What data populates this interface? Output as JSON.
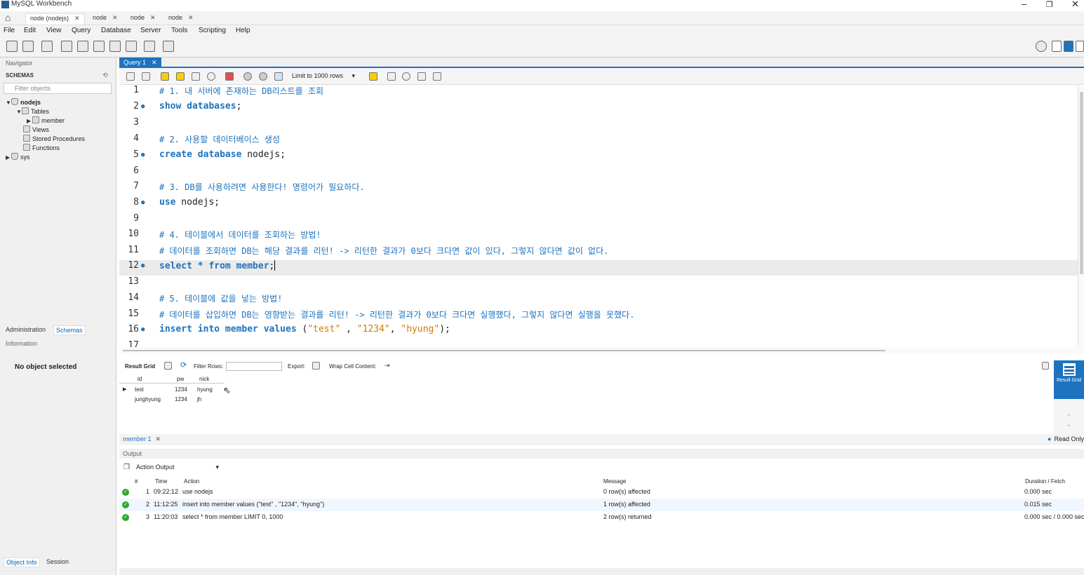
{
  "app": {
    "title": "MySQL Workbench"
  },
  "connection_tabs": [
    {
      "label": "node (nodejs)"
    },
    {
      "label": "node"
    },
    {
      "label": "node"
    },
    {
      "label": "node"
    }
  ],
  "menu": [
    "File",
    "Edit",
    "View",
    "Query",
    "Database",
    "Server",
    "Tools",
    "Scripting",
    "Help"
  ],
  "navigator": {
    "header": "Navigator",
    "schemas_label": "SCHEMAS",
    "filter_placeholder": "Filter objects",
    "tree": {
      "db1": "nodejs",
      "tables": "Tables",
      "member": "member",
      "views": "Views",
      "procs": "Stored Procedures",
      "funcs": "Functions",
      "db2": "sys"
    },
    "tabs": [
      "Administration",
      "Schemas"
    ],
    "information": "Information",
    "no_object": "No object selected",
    "bottom_tabs": [
      "Object Info",
      "Session"
    ]
  },
  "editor": {
    "tab": "Query 1",
    "limit": "Limit to 1000 rows",
    "lines": [
      {
        "n": "1",
        "text": "# 1. 내 서버에 존재하는 DB리스트를 조회"
      },
      {
        "n": "2",
        "kw": "show databases",
        "rest": ";"
      },
      {
        "n": "3"
      },
      {
        "n": "4",
        "text": "# 2. 사용할 데이터베이스 생성"
      },
      {
        "n": "5",
        "kw": "create database",
        "rest": " nodejs;"
      },
      {
        "n": "6"
      },
      {
        "n": "7",
        "text": "# 3. DB를 사용하려면 사용한다! 명령어가 필요하다."
      },
      {
        "n": "8",
        "kw": "use",
        "rest": " nodejs;"
      },
      {
        "n": "9"
      },
      {
        "n": "10",
        "text": "# 4. 테이블에서 데이터를 조회하는 방법!"
      },
      {
        "n": "11",
        "text": "# 데이터를 조회하면 DB는 해당 결과를 리턴! -> 리턴한 결과가 0보다 크다면 값이 있다, 그렇지 않다면 값이 없다."
      },
      {
        "n": "12",
        "kw": "select * from member",
        "rest": ";"
      },
      {
        "n": "13"
      },
      {
        "n": "14",
        "text": "# 5. 테이블에 값을 넣는 방법!"
      },
      {
        "n": "15",
        "text": "# 데이터를 삽입하면 DB는 영향받는 결과를 리턴! -> 리턴한 결과가 0보다 크다면 실행했다, 그렇지 않다면 실행을 못했다."
      },
      {
        "n": "16",
        "kw": "insert into member values",
        "s1": "\"test\"",
        "s2": "\"1234\"",
        "s3": "\"hyung\""
      },
      {
        "n": "17"
      }
    ]
  },
  "result": {
    "grid_label": "Result Grid",
    "filter_label": "Filter Rows:",
    "export_label": "Export:",
    "wrap_label": "Wrap Cell Content:",
    "columns": [
      "id",
      "pw",
      "nick"
    ],
    "rows": [
      [
        "test",
        "1234",
        "hyung"
      ],
      [
        "junghyung",
        "1234",
        "jh"
      ]
    ],
    "side_button": "Result Grid",
    "tab": "member 1",
    "read_only": "Read Only"
  },
  "output": {
    "header": "Output",
    "select": "Action Output",
    "columns": [
      "#",
      "Time",
      "Action",
      "Message",
      "Duration / Fetch"
    ],
    "rows": [
      {
        "n": "1",
        "time": "09:22:12",
        "action": "use nodejs",
        "message": "0 row(s) affected",
        "duration": "0.000 sec"
      },
      {
        "n": "2",
        "time": "11:12:25",
        "action": "insert into member values (\"test\" , \"1234\", \"hyung\")",
        "message": "1 row(s) affected",
        "duration": "0.015 sec"
      },
      {
        "n": "3",
        "time": "11:20:03",
        "action": "select * from member LIMIT 0, 1000",
        "message": "2 row(s) returned",
        "duration": "0.000 sec / 0.000 sec"
      }
    ]
  },
  "colors": {
    "accent": "#1e73be",
    "string": "#d07a00",
    "ok": "#2fa82f"
  }
}
